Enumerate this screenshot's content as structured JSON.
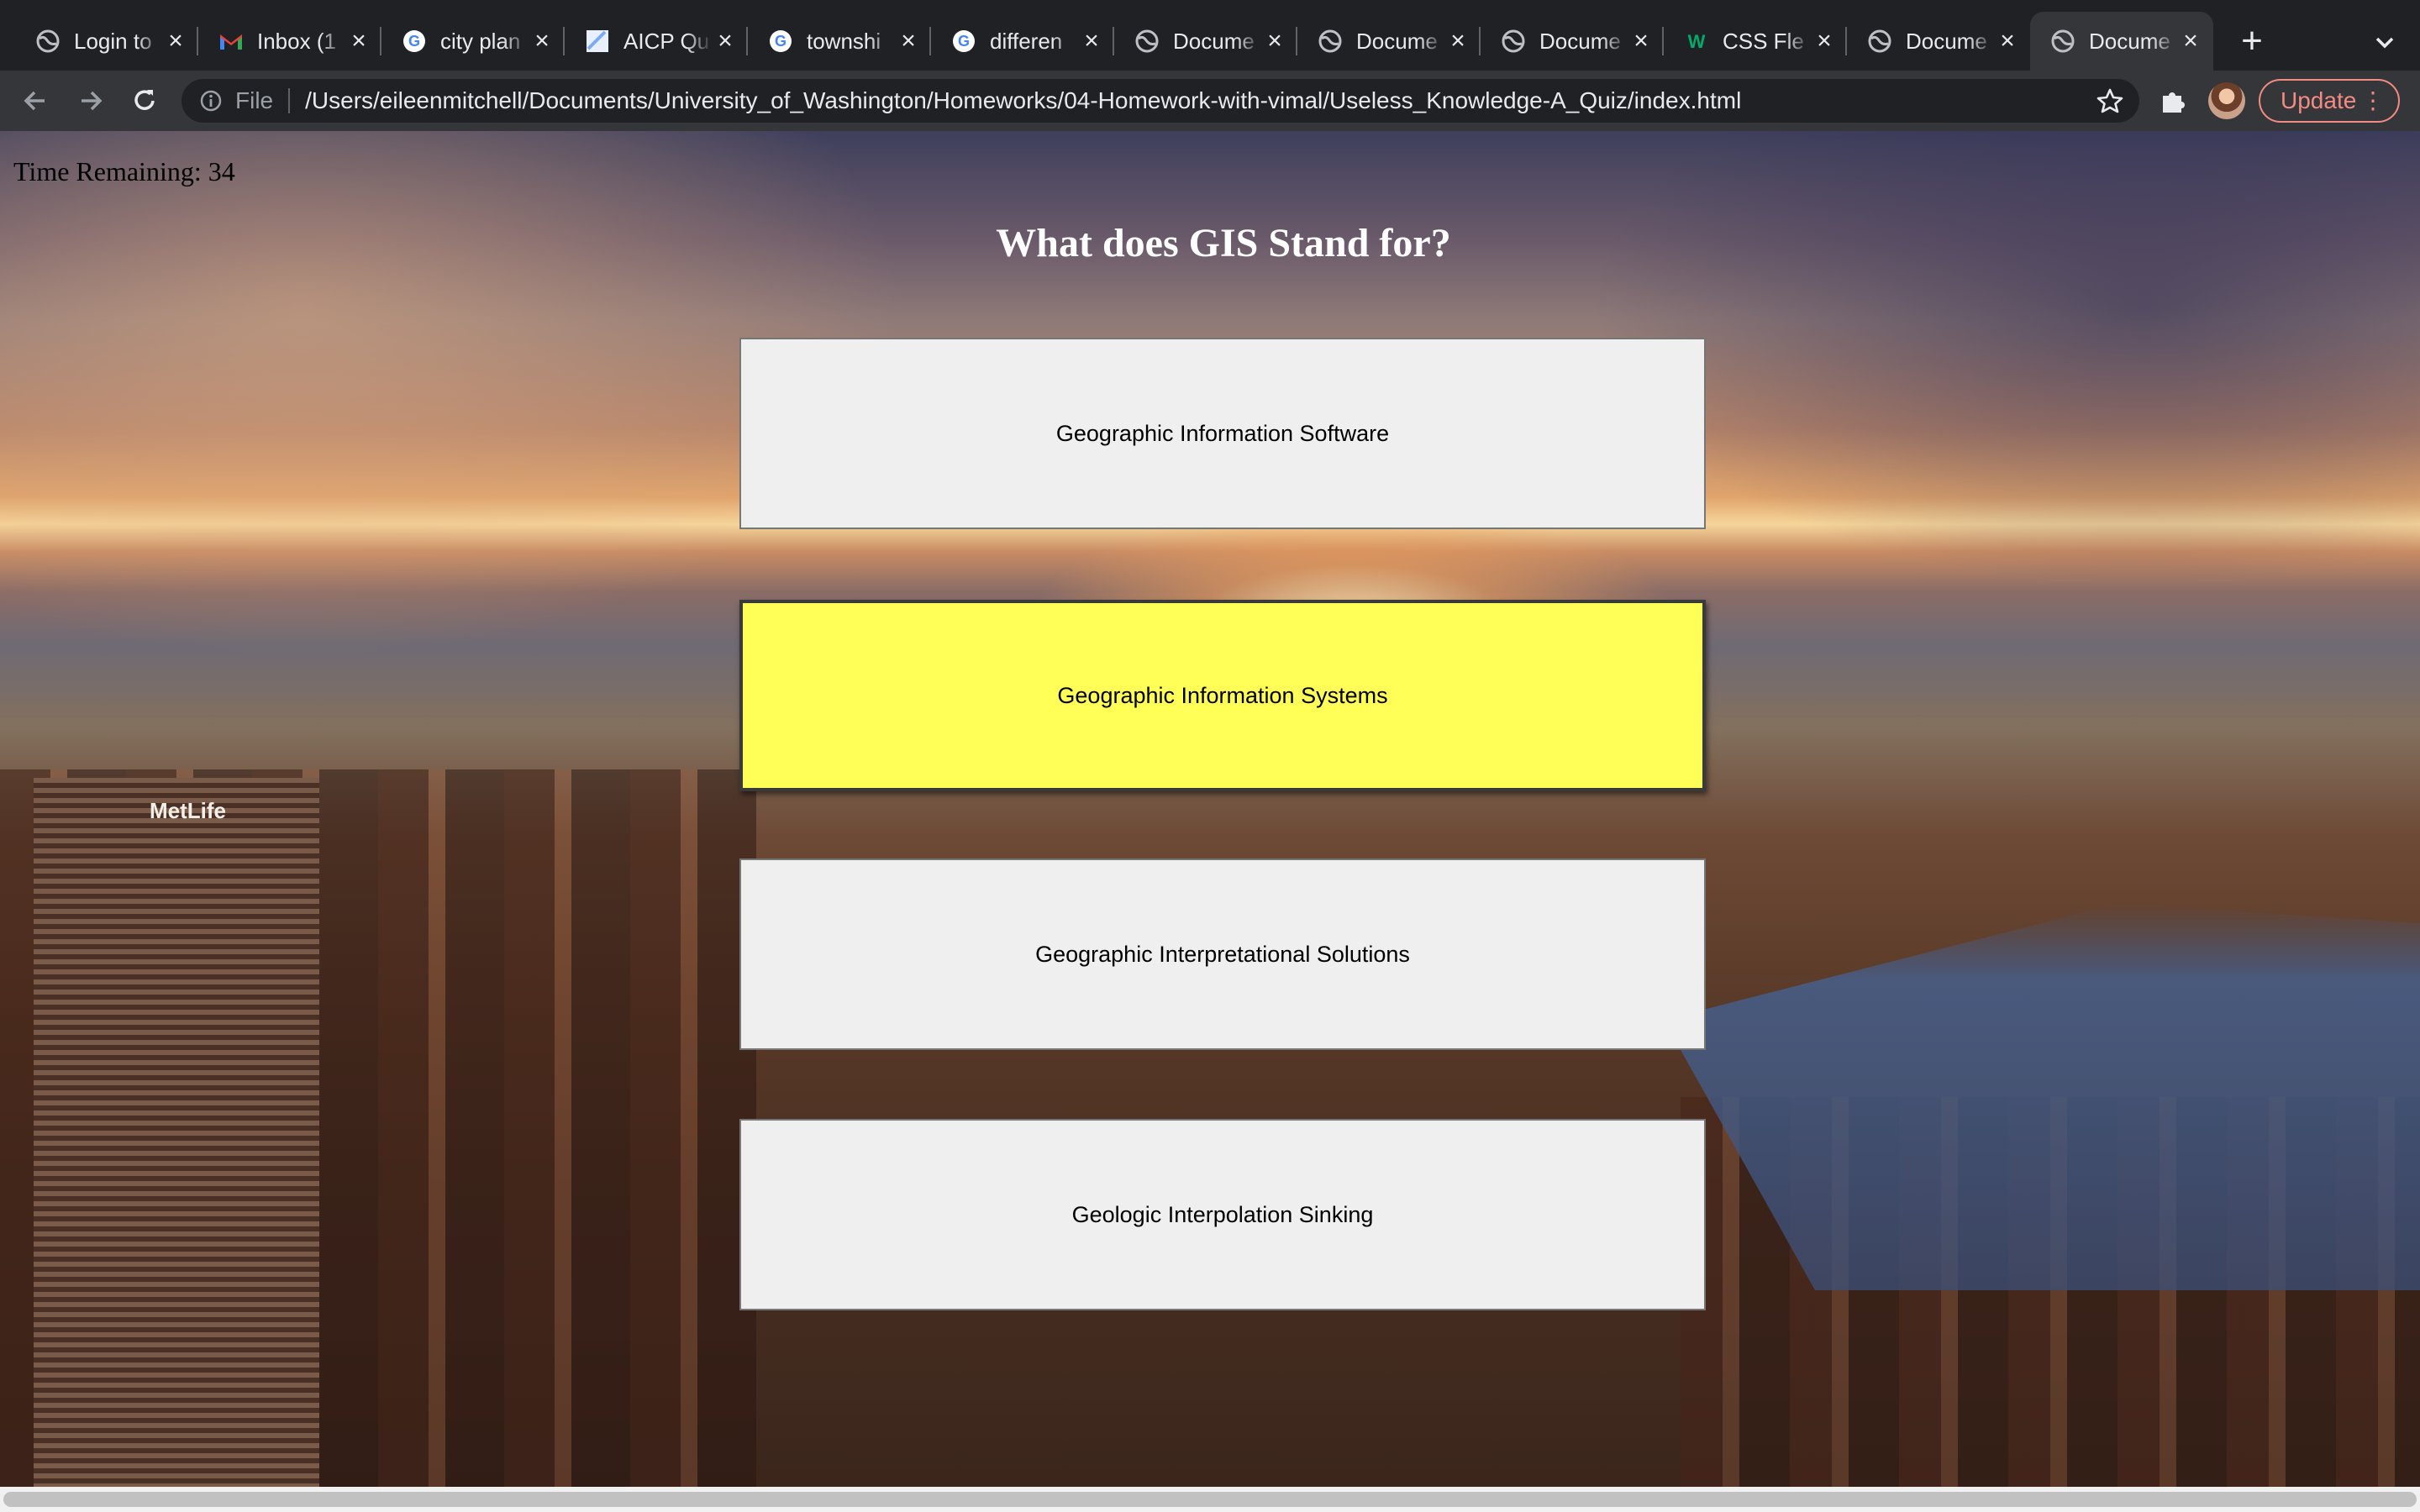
{
  "browser": {
    "tabs": [
      {
        "title": "Login to",
        "favicon": "globe-icon"
      },
      {
        "title": "Inbox (1",
        "favicon": "gmail-icon"
      },
      {
        "title": "city plan",
        "favicon": "google-icon"
      },
      {
        "title": "AICP Qu",
        "favicon": "aicp-icon"
      },
      {
        "title": "townshi",
        "favicon": "google-icon"
      },
      {
        "title": "differen",
        "favicon": "google-icon"
      },
      {
        "title": "Docume",
        "favicon": "globe-icon"
      },
      {
        "title": "Docume",
        "favicon": "globe-icon"
      },
      {
        "title": "Docume",
        "favicon": "globe-icon"
      },
      {
        "title": "CSS Fle",
        "favicon": "w3schools-icon"
      },
      {
        "title": "Docume",
        "favicon": "globe-icon"
      },
      {
        "title": "Docume",
        "favicon": "globe-icon",
        "active": true
      }
    ],
    "address": {
      "scheme_label": "File",
      "url": "/Users/eileenmitchell/Documents/University_of_Washington/Homeworks/04-Homework-with-vimal/Useless_Knowledge-A_Quiz/index.html"
    },
    "update_label": "Update",
    "colors": {
      "tabstrip": "#202124",
      "toolbar": "#35363a",
      "update_accent": "#f28b82"
    }
  },
  "quiz": {
    "timer_label": "Time Remaining: 34",
    "question": "What does GIS Stand for?",
    "answers": [
      "Geographic Information Software",
      "Geographic Information Systems",
      "Geographic Interpretational Solutions",
      "Geologic Interpolation Sinking"
    ],
    "hovered_answer_index": 1,
    "colors": {
      "answer_bg": "#efefef",
      "answer_hover_bg": "#ffff57",
      "question_text": "#ffffff"
    }
  },
  "background": {
    "sign_text": "MetLife"
  }
}
